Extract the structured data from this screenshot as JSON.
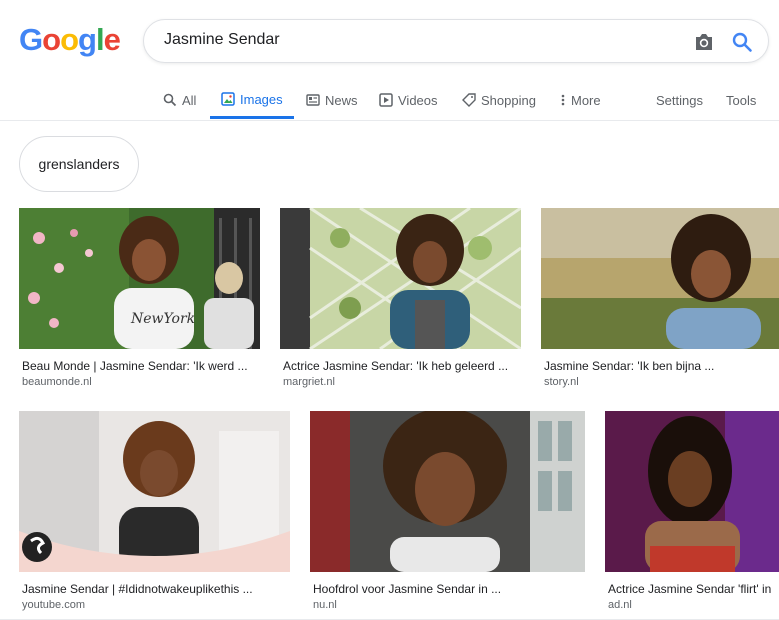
{
  "search": {
    "query": "Jasmine Sendar"
  },
  "tabs": [
    {
      "label": "All"
    },
    {
      "label": "Images"
    },
    {
      "label": "News"
    },
    {
      "label": "Videos"
    },
    {
      "label": "Shopping"
    },
    {
      "label": "More"
    }
  ],
  "tools": {
    "settings": "Settings",
    "tools": "Tools"
  },
  "chips": [
    "grenslanders"
  ],
  "results": [
    {
      "caption": "Beau Monde | Jasmine Sendar: 'Ik werd ...",
      "source": "beaumonde.nl"
    },
    {
      "caption": "Actrice Jasmine Sendar: 'Ik heb geleerd ...",
      "source": "margriet.nl"
    },
    {
      "caption": "Jasmine Sendar: 'Ik ben bijna ...",
      "source": "story.nl"
    },
    {
      "caption": "Jasmine Sendar | #Ididnotwakeuplikethis ...",
      "source": "youtube.com"
    },
    {
      "caption": "Hoofdrol voor Jasmine Sendar in ...",
      "source": "nu.nl"
    },
    {
      "caption": "Actrice Jasmine Sendar 'flirt' in",
      "source": "ad.nl"
    }
  ],
  "colors": {
    "accent": "#1a73e8",
    "text_secondary": "#5f6368"
  }
}
